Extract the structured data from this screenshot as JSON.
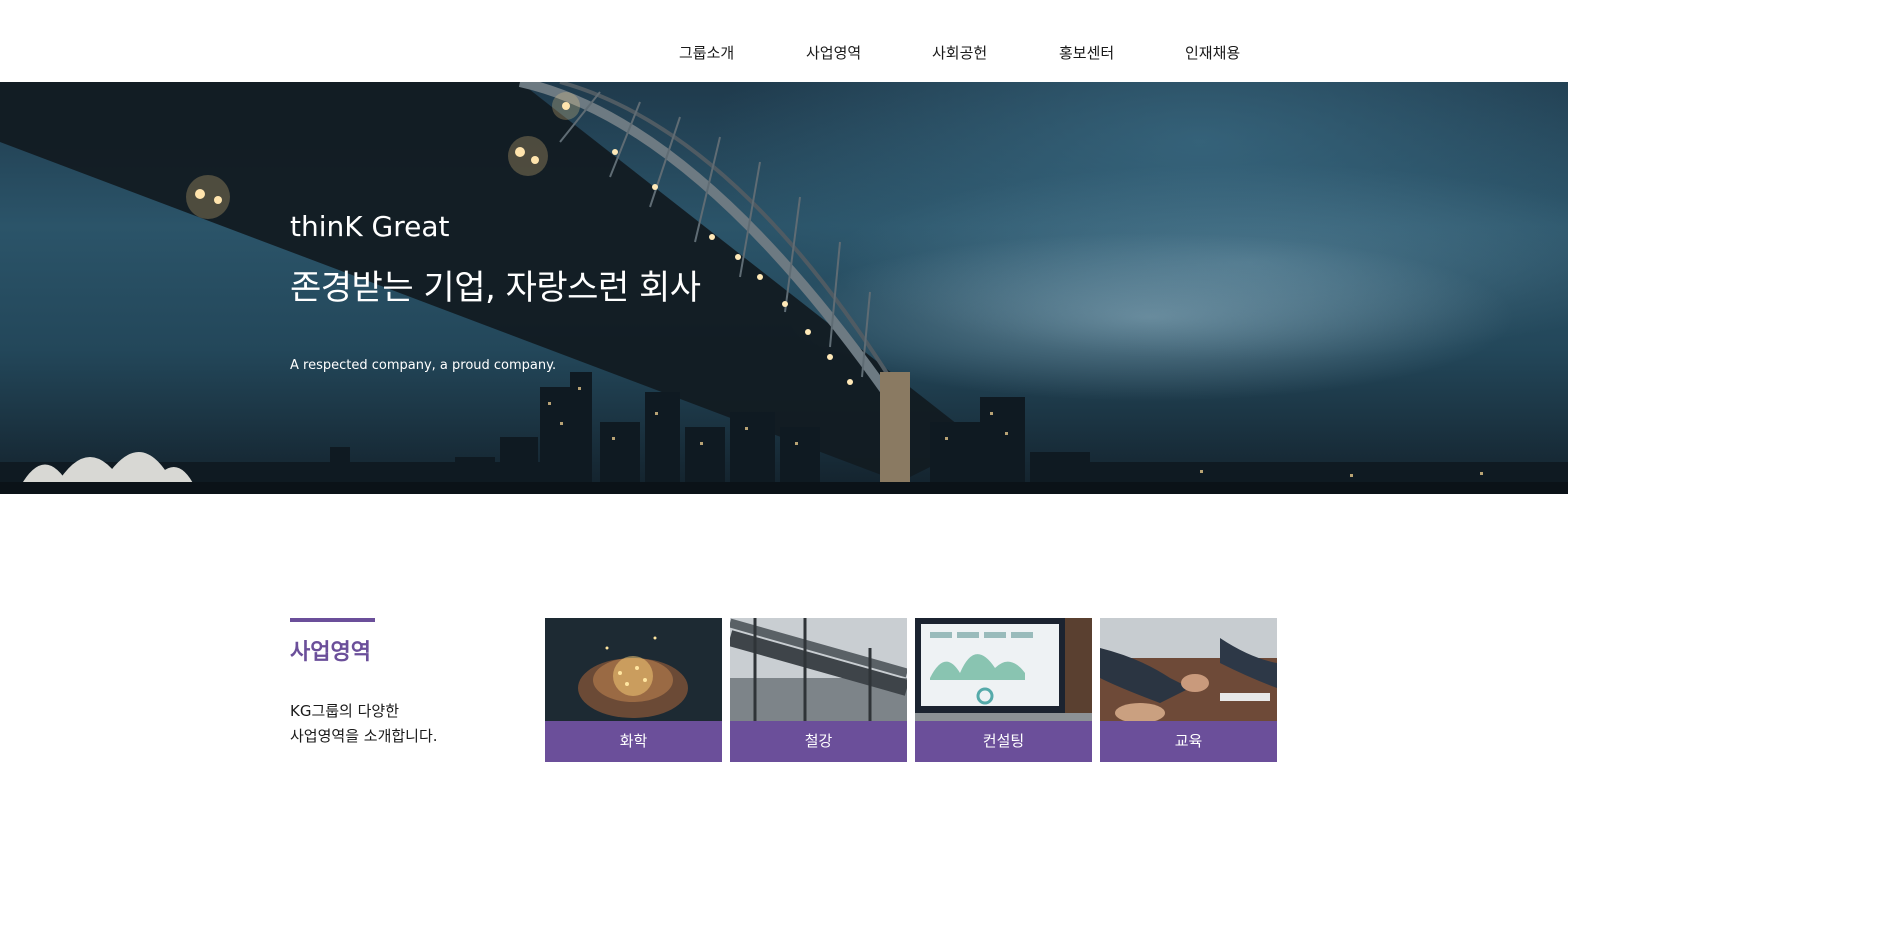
{
  "nav": {
    "items": [
      {
        "label": "그룹소개"
      },
      {
        "label": "사업영역"
      },
      {
        "label": "사회공헌"
      },
      {
        "label": "홍보센터"
      },
      {
        "label": "인재채용"
      }
    ]
  },
  "hero": {
    "title": "thinK Great",
    "subtitle": "존경받는 기업, 자랑스런 회사",
    "tagline": "A respected company, a proud company."
  },
  "business": {
    "title": "사업영역",
    "desc_line1": "KG그룹의 다양한",
    "desc_line2": "사업영역을 소개합니다.",
    "cards": [
      {
        "label": "화학"
      },
      {
        "label": "철강"
      },
      {
        "label": "컨설팅"
      },
      {
        "label": "교육"
      }
    ]
  },
  "colors": {
    "accent": "#6b4f9a"
  }
}
